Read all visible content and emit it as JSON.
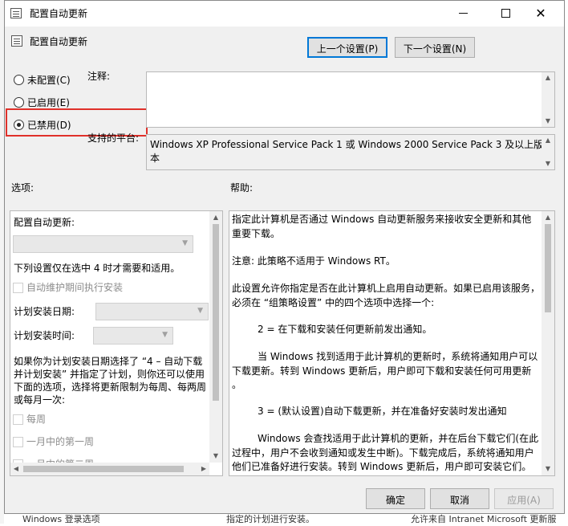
{
  "window": {
    "title": "配置自动更新",
    "policy_name": "配置自动更新",
    "prev_button": "上一个设置(P)",
    "next_button": "下一个设置(N)"
  },
  "radios": [
    {
      "label": "未配置(C)",
      "selected": false
    },
    {
      "label": "已启用(E)",
      "selected": false
    },
    {
      "label": "已禁用(D)",
      "selected": true
    }
  ],
  "labels": {
    "comment": "注释:",
    "supported_on": "支持的平台:",
    "options": "选项:",
    "help": "帮助:"
  },
  "supported": {
    "line1": "Windows XP Professional Service Pack 1 或 Windows 2000 Service Pack 3 及以上版",
    "line2": "本"
  },
  "options": {
    "configure_label": "配置自动更新:",
    "note": "下列设置仅在选中 4 时才需要和适用。",
    "maintenance_checkbox": "自动维护期间执行安装",
    "schedule_day_label": "计划安装日期:",
    "schedule_time_label": "计划安装时间:",
    "desc1": "如果你为计划安装日期选择了 “4 – 自动下载",
    "desc2": "并计划安装” 并指定了计划，则你还可以使用",
    "desc3": "下面的选项，选择将更新限制为每周、每两周",
    "desc4": "或每月一次:",
    "weekly": "每周",
    "first_week": "一月中的第一周",
    "second_week": "一月中的第二周"
  },
  "help": {
    "p1a": "指定此计算机是否通过 Windows 自动更新服务来接收安全更新和其他",
    "p1b": "重要下载。",
    "p2": "注意: 此策略不适用于 Windows RT。",
    "p3a": "此设置允许你指定是否在此计算机上启用自动更新。如果已启用该服务，",
    "p3b": "必须在 “组策略设置” 中的四个选项中选择一个:",
    "p4": "2 = 在下载和安装任何更新前发出通知。",
    "p5a": "当 Windows 找到适用于此计算机的更新时，系统将通知用户可以",
    "p5b": "下载更新。转到 Windows 更新后，用户即可下载和安装任何可用更新",
    "p5c": "。",
    "p6": "3 = (默认设置)自动下载更新，并在准备好安装时发出通知",
    "p7a": "Windows 会查找适用于此计算机的更新，并在后台下载它们(在此",
    "p7b": "过程中，用户不会收到通知或发生中断)。下载完成后，系统将通知用户",
    "p7c": "他们已准备好进行安装。转到 Windows 更新后，用户即可安装它们。"
  },
  "footer": {
    "ok": "确定",
    "cancel": "取消",
    "apply": "应用(A)"
  },
  "background": {
    "left_item": "Windows 登录选项",
    "middle_text": "指定的计划进行安装。",
    "right_text": "允许来自 Intranet Microsoft 更新服"
  },
  "colors": {
    "highlight_box": "#e0312a",
    "default_button_border": "#0078d7"
  }
}
